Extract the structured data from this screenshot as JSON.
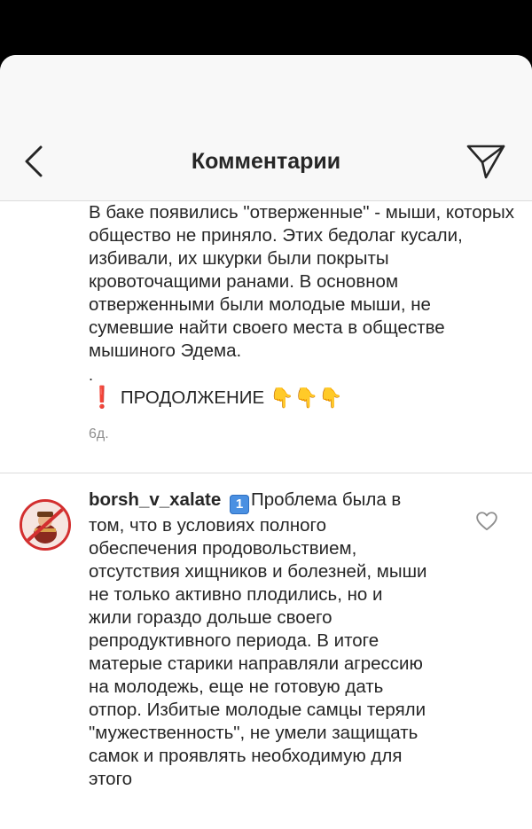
{
  "header": {
    "title": "Комментарии"
  },
  "previous_comment": {
    "text": "В баке появились \"отверженные\" - мыши, которых общество не приняло. Этих бедолаг кусали, избивали, их шкурки были покрыты кровоточащими ранами. В основном отверженными были молодые мыши, не сумевшие найти своего места в обществе мышиного Эдема.",
    "dot": ".",
    "continuation_label": "ПРОДОЛЖЕНИЕ",
    "continuation_emoji": "👇👇👇",
    "exclamation": "❗",
    "time": "6д."
  },
  "comment": {
    "username": "borsh_v_xalate",
    "number_badge": "1",
    "text": "Проблема была в том, что в условиях полного обеспечения продовольствием, отсутствия хищников и болезней, мыши не только активно плодились, но и жили гораздо дольше своего репродуктивного периода. В итоге матерые старики направляли агрессию на молодежь, еще не готовую дать отпор. Избитые молодые самцы теряли \"мужественность\", не умели защищать самок и проявлять необходимую для этого"
  },
  "icons": {
    "back": "chevron-left-icon",
    "send": "paper-plane-icon",
    "like": "heart-outline-icon"
  },
  "colors": {
    "header_bg": "#f8f8f8",
    "text": "#262626",
    "muted": "#8e8e8e",
    "divider": "#dbdbdb",
    "accent_red": "#d32f2f"
  }
}
